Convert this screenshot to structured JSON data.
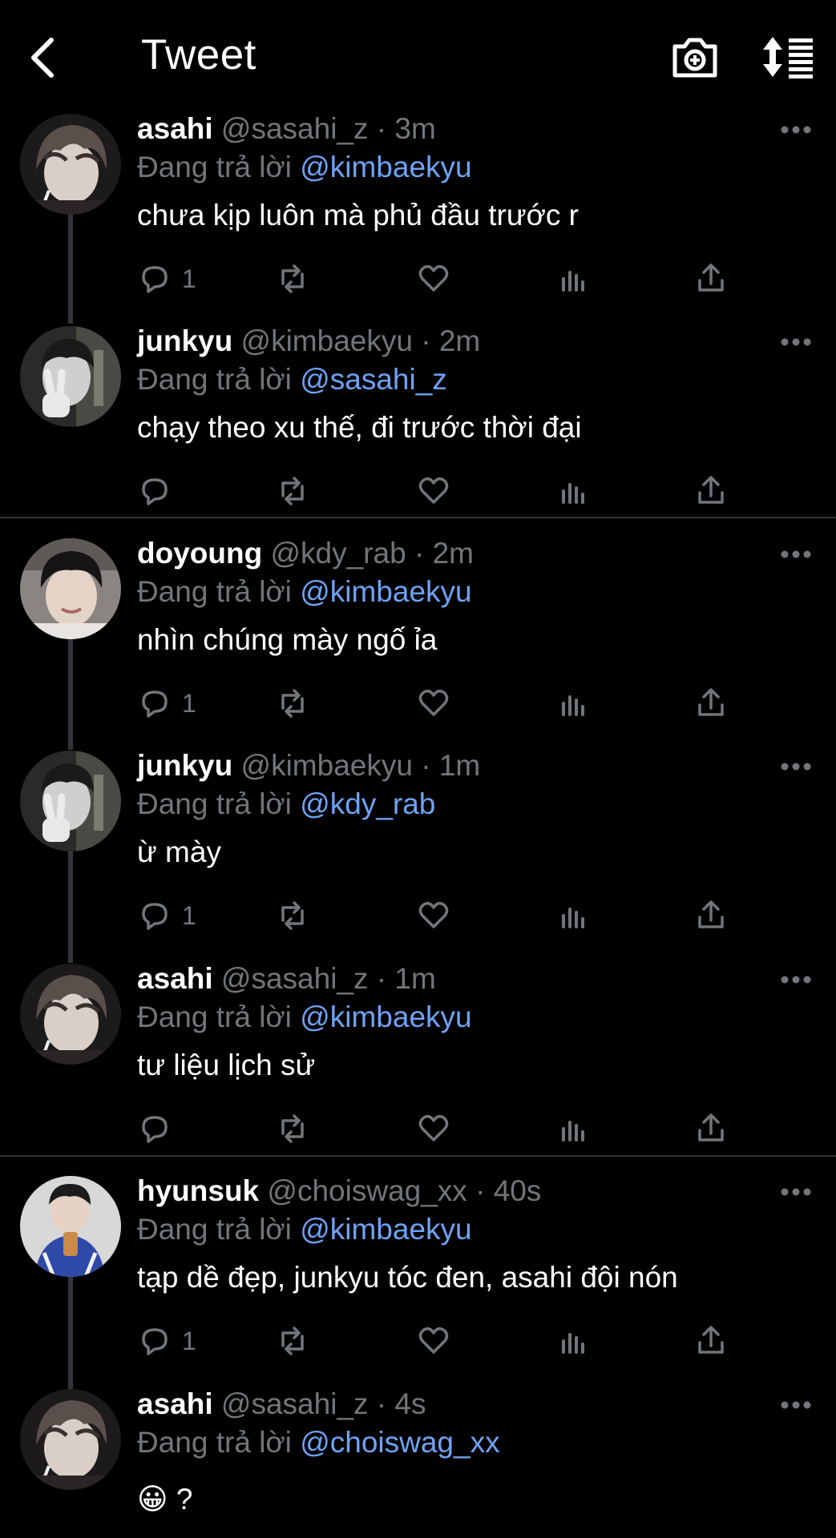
{
  "header": {
    "title": "Tweet"
  },
  "reply_label": "Đang trả lời",
  "tweets": [
    {
      "name": "asahi",
      "handle": "@sasahi_z",
      "time": "3m",
      "reply_to": "@kimbaekyu",
      "text": "chưa kịp luôn mà phủ đầu trước r",
      "replies": "1",
      "avatar": "asahi"
    },
    {
      "name": "junkyu",
      "handle": "@kimbaekyu",
      "time": "2m",
      "reply_to": "@sasahi_z",
      "text": "chạy theo xu thế, đi trước thời đại",
      "replies": "",
      "avatar": "junkyu"
    },
    {
      "name": "doyoung",
      "handle": "@kdy_rab",
      "time": "2m",
      "reply_to": "@kimbaekyu",
      "text": "nhìn chúng mày ngố ỉa",
      "replies": "1",
      "avatar": "doyoung"
    },
    {
      "name": "junkyu",
      "handle": "@kimbaekyu",
      "time": "1m",
      "reply_to": "@kdy_rab",
      "text": "ừ mày",
      "replies": "1",
      "avatar": "junkyu"
    },
    {
      "name": "asahi",
      "handle": "@sasahi_z",
      "time": "1m",
      "reply_to": "@kimbaekyu",
      "text": "tư liệu lịch sử",
      "replies": "",
      "avatar": "asahi"
    },
    {
      "name": "hyunsuk",
      "handle": "@choiswag_xx",
      "time": "40s",
      "reply_to": "@kimbaekyu",
      "text": "tạp dề đẹp, junkyu tóc đen, asahi đội nón",
      "replies": "1",
      "avatar": "hyunsuk"
    },
    {
      "name": "asahi",
      "handle": "@sasahi_z",
      "time": "4s",
      "reply_to": "@choiswag_xx",
      "text": "😀 ?",
      "replies": "",
      "avatar": "asahi"
    }
  ],
  "colors": {
    "background": "#000000",
    "text": "#e7e9ea",
    "secondary": "#71767b",
    "link": "#6ea3f5",
    "divider": "#2f3336"
  }
}
